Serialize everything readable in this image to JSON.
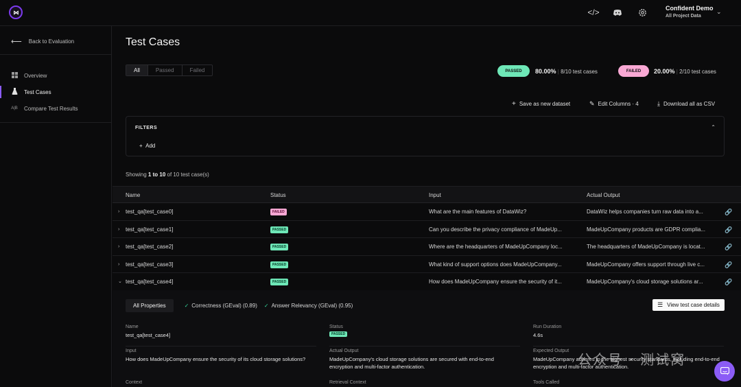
{
  "topbar": {
    "logo_text": "⋈",
    "icons": [
      "code-icon",
      "discord-icon",
      "settings-icon"
    ],
    "project_name": "Confident Demo",
    "project_scope": "All Project Data"
  },
  "sidebar": {
    "back_label": "Back to Evaluation",
    "items": [
      {
        "label": "Overview",
        "icon": "grid-icon"
      },
      {
        "label": "Test Cases",
        "icon": "flask-icon",
        "active": true
      },
      {
        "label": "Compare Test Results",
        "icon": "ab-icon",
        "icon_text": "A|B"
      }
    ]
  },
  "page": {
    "title": "Test Cases",
    "filter_tabs": [
      "All",
      "Passed",
      "Failed"
    ],
    "passed_badge": "PASSED",
    "passed_pct": "80.00%",
    "passed_count": "8/10 test cases",
    "failed_badge": "FAILED",
    "failed_pct": "20.00%",
    "failed_count": "2/10 test cases",
    "actions": {
      "save": "Save as new dataset",
      "edit": "Edit Columns · 4",
      "download": "Download all as CSV"
    },
    "filters_label": "FILTERS",
    "add_label": "Add",
    "showing_prefix": "Showing ",
    "showing_range": "1 to 10",
    "showing_suffix": " of 10 test case(s)"
  },
  "table": {
    "headers": [
      "Name",
      "Status",
      "Input",
      "Actual Output"
    ],
    "rows": [
      {
        "name": "test_qa[test_case0]",
        "status": "FAILED",
        "input": "What are the main features of DataWiz?",
        "output": "DataWiz helps companies turn raw data into a..."
      },
      {
        "name": "test_qa[test_case1]",
        "status": "PASSED",
        "input": "Can you describe the privacy compliance of MadeUp...",
        "output": "MadeUpCompany products are GDPR complia..."
      },
      {
        "name": "test_qa[test_case2]",
        "status": "PASSED",
        "input": "Where are the headquarters of MadeUpCompany loc...",
        "output": "The headquarters of MadeUpCompany is locat..."
      },
      {
        "name": "test_qa[test_case3]",
        "status": "PASSED",
        "input": "What kind of support options does MadeUpCompany...",
        "output": "MadeUpCompany offers support through live c..."
      },
      {
        "name": "test_qa[test_case4]",
        "status": "PASSED",
        "input": "How does MadeUpCompany ensure the security of it...",
        "output": "MadeUpCompany's cloud storage solutions ar..."
      }
    ]
  },
  "detail": {
    "tab_all": "All Properties",
    "metric1": "Correctness (GEval) (0.89)",
    "metric2": "Answer Relevancy (GEval) (0.95)",
    "view_button": "View test case details",
    "name_label": "Name",
    "name_value": "test_qa[test_case4]",
    "status_label": "Status",
    "status_value": "PASSED",
    "duration_label": "Run Duration",
    "duration_value": "4.6s",
    "input_label": "Input",
    "input_value": "How does MadeUpCompany ensure the security of its cloud storage solutions?",
    "actual_label": "Actual Output",
    "actual_value": "MadeUpCompany's cloud storage solutions are secured with end-to-end encryption and multi-factor authentication.",
    "expected_label": "Expected Output",
    "expected_value": "MadeUpCompany adheres to the highest security standards, including end-to-end encryption and multi-factor authentication.",
    "context_label": "Context",
    "retrieval_label": "Retrieval Context",
    "tools_label": "Tools Called"
  },
  "watermark": "公众号 · 测试窝"
}
